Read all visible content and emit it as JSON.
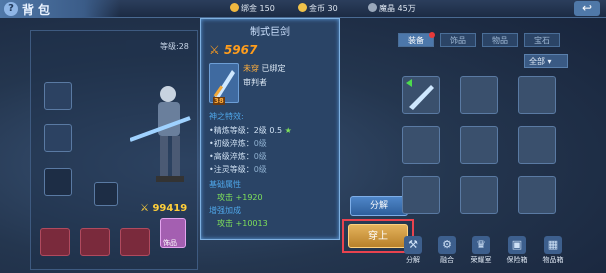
{
  "header": {
    "title": "背包",
    "currencies": [
      {
        "label": "绑金",
        "value": "150",
        "icon": "bound-gold-icon",
        "color": "#f0b840"
      },
      {
        "label": "金币",
        "value": "30",
        "icon": "gold-coin-icon",
        "color": "#f0c24a"
      },
      {
        "label": "魔晶",
        "value": "45万",
        "icon": "crystal-icon",
        "color": "#9aa8bb"
      }
    ]
  },
  "character": {
    "level_label": "等级:28",
    "power": "99419"
  },
  "tooltip": {
    "title": "制式巨剑",
    "score": "5967",
    "item_level": "38",
    "status_unworn": "未穿",
    "status_bound": "已绑定",
    "class": "审判者",
    "section_spirit": "神之特效:",
    "refine_rows": [
      {
        "label": "•精炼等级：2级",
        "value": "0.5"
      },
      {
        "label": "•初级淬炼：",
        "value": "0级"
      },
      {
        "label": "•高级淬炼：",
        "value": "0级"
      },
      {
        "label": "•注灵等级：",
        "value": "0级"
      }
    ],
    "section_base": "基础属性",
    "base_attr": "攻击 +1920",
    "section_extra": "增强加成",
    "extra_attr": "攻击 +10013"
  },
  "actions": {
    "decompose": "分解",
    "equip": "穿上"
  },
  "tabs": [
    {
      "label": "装备",
      "active": true,
      "badge": true
    },
    {
      "label": "饰品"
    },
    {
      "label": "物品"
    },
    {
      "label": "宝石"
    }
  ],
  "filter": "全部",
  "bottom_bar": [
    {
      "label": "分解",
      "icon": "decompose-icon"
    },
    {
      "label": "融合",
      "icon": "fuse-icon"
    },
    {
      "label": "荣耀室",
      "icon": "honor-icon"
    },
    {
      "label": "保险箱",
      "icon": "safe-icon"
    },
    {
      "label": "物品箱",
      "icon": "item-box-icon"
    }
  ],
  "accessory_label": "饰品"
}
